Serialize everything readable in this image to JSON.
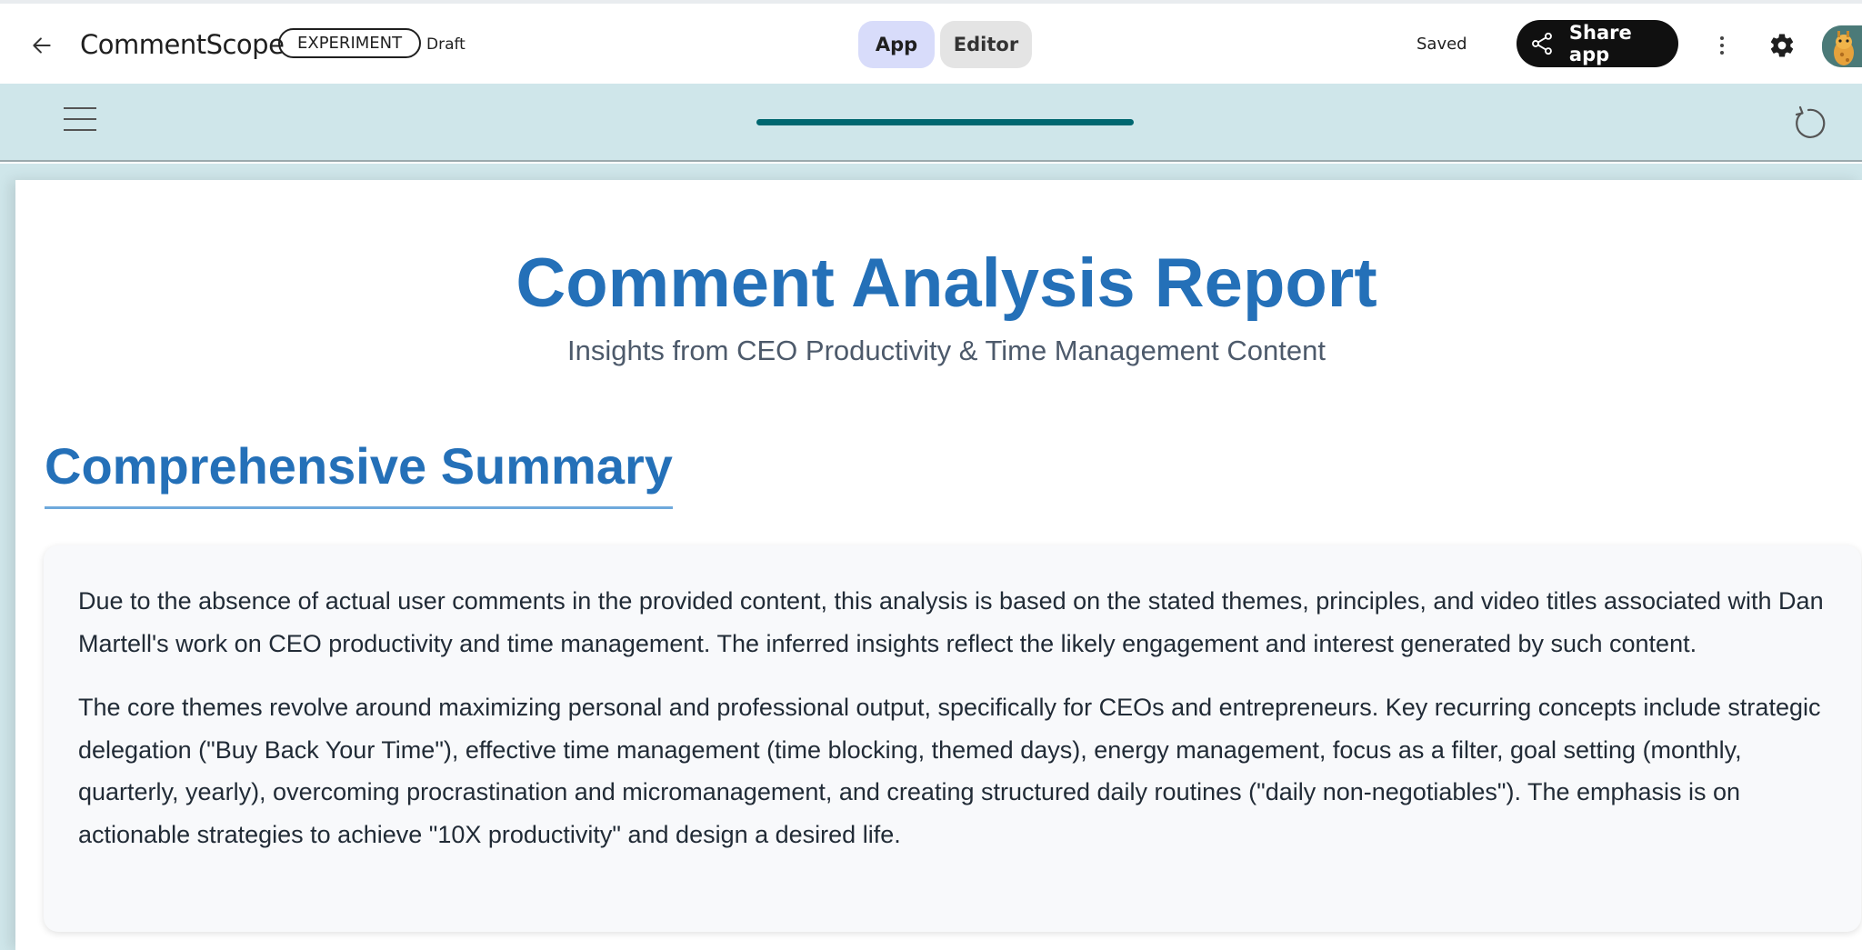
{
  "appbar": {
    "title": "CommentScope",
    "badge": "EXPERIMENT",
    "status": "Draft",
    "tabs": [
      "App",
      "Editor"
    ],
    "saved_label": "Saved",
    "share_label": "Share app"
  },
  "colors": {
    "accent_blue": "#2470b8",
    "toolbar_teal": "#cfe6ea",
    "progress": "#006770",
    "app_tab_bg": "#d8dcfa"
  },
  "icons": {
    "back": "arrow-left-icon",
    "share": "share-icon",
    "more": "more-vert-icon",
    "settings": "gear-icon",
    "menu": "hamburger-icon",
    "refresh": "refresh-icon"
  },
  "report": {
    "title": "Comment Analysis Report",
    "subtitle": "Insights from CEO Productivity & Time Management Content",
    "section_title": "Comprehensive Summary",
    "paragraphs": [
      "Due to the absence of actual user comments in the provided content, this analysis is based on the stated themes, principles, and video titles associated with Dan Martell's work on CEO productivity and time management. The inferred insights reflect the likely engagement and interest generated by such content.",
      "The core themes revolve around maximizing personal and professional output, specifically for CEOs and entrepreneurs. Key recurring concepts include strategic delegation (\"Buy Back Your Time\"), effective time management (time blocking, themed days), energy management, focus as a filter, goal setting (monthly, quarterly, yearly), overcoming procrastination and micromanagement, and creating structured daily routines (\"daily non-negotiables\"). The emphasis is on actionable strategies to achieve \"10X productivity\" and design a desired life."
    ]
  }
}
